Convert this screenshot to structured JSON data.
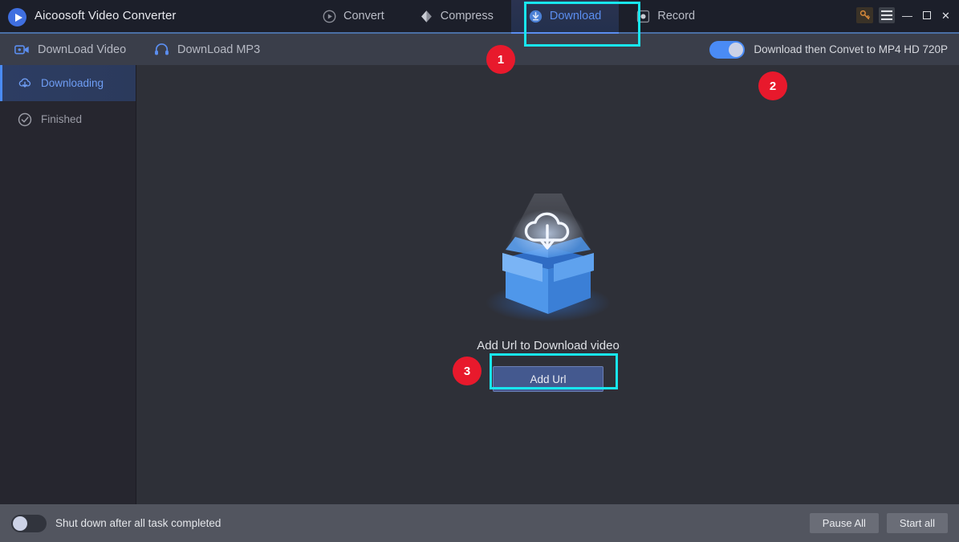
{
  "window": {
    "app_title": "Aicoosoft Video Converter",
    "logo_icon": "play-circle-icon",
    "key_icon": "key-icon",
    "menu_icon": "hamburger-menu-icon",
    "minimize_icon": "minimize-icon",
    "maximize_icon": "maximize-icon",
    "close_icon": "close-icon",
    "minimize_glyph": "—",
    "maximize_glyph": "❐",
    "close_glyph": "✕"
  },
  "nav_tabs": [
    {
      "label": "Convert",
      "icon": "convert-icon",
      "active": false
    },
    {
      "label": "Compress",
      "icon": "compress-icon",
      "active": false
    },
    {
      "label": "Download",
      "icon": "download-icon",
      "active": true
    },
    {
      "label": "Record",
      "icon": "record-icon",
      "active": false
    }
  ],
  "subnav": {
    "items": [
      {
        "label": "DownLoad Video",
        "icon": "video-camera-icon"
      },
      {
        "label": "DownLoad MP3",
        "icon": "headphones-icon"
      }
    ],
    "convert_toggle": {
      "label": "Download then Convet to MP4 HD 720P",
      "state": "on"
    }
  },
  "sidebar": {
    "items": [
      {
        "label": "Downloading",
        "icon": "cloud-download-icon",
        "active": true
      },
      {
        "label": "Finished",
        "icon": "check-circle-icon",
        "active": false
      }
    ]
  },
  "main": {
    "illustration": "open-box-cloud-download-illustration",
    "empty_text": "Add Url to Download video",
    "add_url_button": "Add Url"
  },
  "bottom_bar": {
    "shutdown_toggle": {
      "label": "Shut down after all task completed",
      "state": "off"
    },
    "pause_all_button": "Pause All",
    "start_all_button": "Start all"
  },
  "annotations": {
    "badges": [
      {
        "number": "1"
      },
      {
        "number": "2"
      },
      {
        "number": "3"
      }
    ],
    "highlight_color": "#18e6ef",
    "badge_color": "#e8192c"
  },
  "colors": {
    "titlebar": "#1c1f2a",
    "subnav": "#3a3e4a",
    "sidebar": "#26262f",
    "main": "#2e3038",
    "bottombar": "#52555f",
    "accent_blue": "#4a8bf5"
  }
}
